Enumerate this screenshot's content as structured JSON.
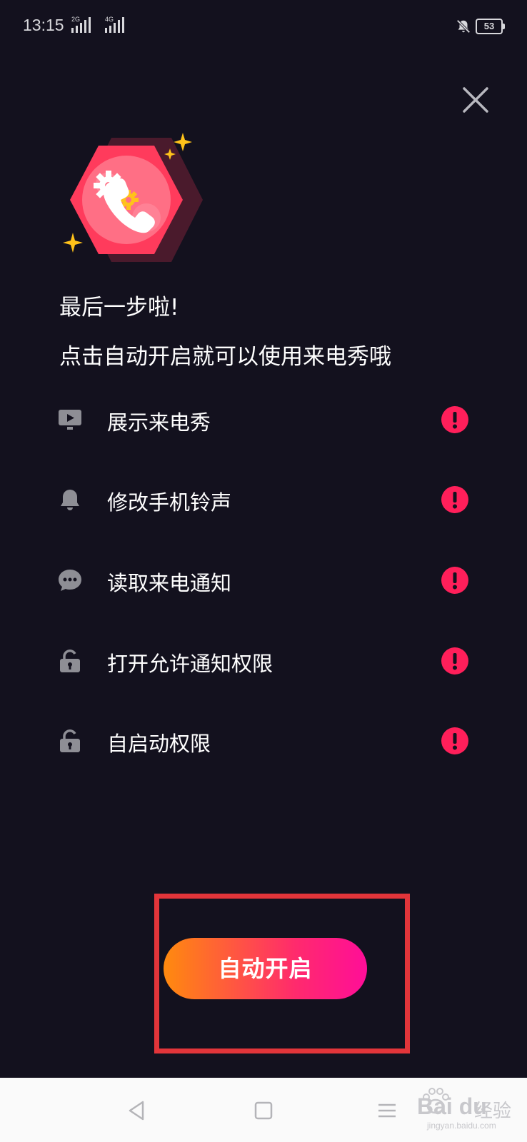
{
  "status_bar": {
    "time": "13:15",
    "signal1_tag": "2G",
    "signal2_tag": "4G",
    "battery": "53",
    "icons": [
      "signal-icon",
      "signal-icon",
      "bell-off-icon",
      "battery-icon"
    ]
  },
  "header": {
    "close_icon": "close-icon"
  },
  "hero": {
    "icon": "call-settings-illustration"
  },
  "content": {
    "title": "最后一步啦!",
    "subtitle": "点击自动开启就可以使用来电秀哦"
  },
  "permissions": [
    {
      "icon": "play-screen-icon",
      "label": "展示来电秀",
      "status_icon": "warning-icon"
    },
    {
      "icon": "bell-icon",
      "label": "修改手机铃声",
      "status_icon": "warning-icon"
    },
    {
      "icon": "chat-bubble-icon",
      "label": "读取来电通知",
      "status_icon": "warning-icon"
    },
    {
      "icon": "lock-icon",
      "label": "打开允许通知权限",
      "status_icon": "warning-icon"
    },
    {
      "icon": "lock-icon",
      "label": "自启动权限",
      "status_icon": "warning-icon"
    }
  ],
  "action": {
    "auto_enable_label": "自动开启"
  },
  "nav_bar": {
    "back_icon": "back-triangle-icon",
    "home_icon": "home-square-icon",
    "menu_icon": "menu-lines-icon"
  },
  "watermark": {
    "brand": "Bai du",
    "brand_cn": "经验",
    "url": "jingyan.baidu.com"
  },
  "colors": {
    "background": "#13111e",
    "accent_red": "#ff1f5a",
    "button_gradient_start": "#ff8a0e",
    "button_gradient_end": "#ff0e98",
    "highlight_box": "#e2353a",
    "icon_gray": "#8e8e95"
  }
}
